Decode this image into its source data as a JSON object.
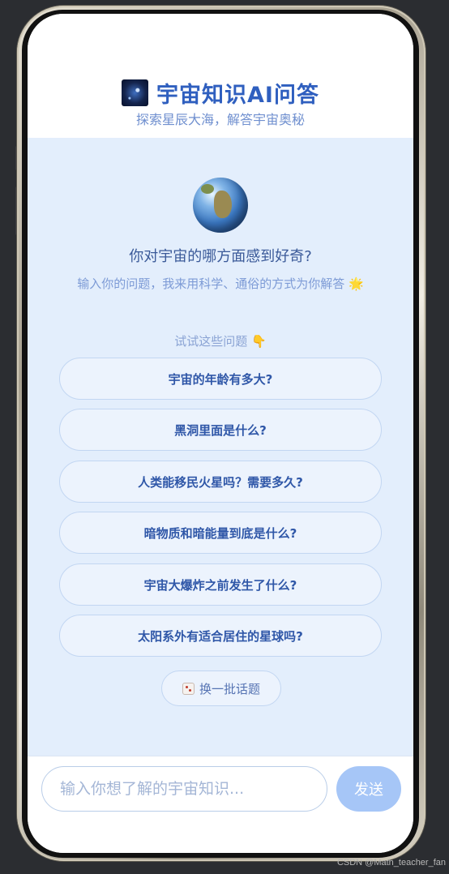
{
  "header": {
    "icon": "galaxy-icon",
    "title": "宇宙知识AI问答",
    "subtitle": "探索星辰大海，解答宇宙奥秘"
  },
  "welcome": {
    "icon": "earth-globe-icon",
    "heading": "你对宇宙的哪方面感到好奇?",
    "intro": "输入你的问题，我来用科学、通俗的方式为你解答 🌟",
    "try_label": "试试这些问题 👇"
  },
  "suggestions": [
    "宇宙的年龄有多大?",
    "黑洞里面是什么?",
    "人类能移民火星吗？需要多久?",
    "暗物质和暗能量到底是什么?",
    "宇宙大爆炸之前发生了什么?",
    "太阳系外有适合居住的星球吗?"
  ],
  "refresh_button": {
    "icon": "dice-icon",
    "label": "换一批话题"
  },
  "input_bar": {
    "placeholder": "输入你想了解的宇宙知识...",
    "value": "",
    "send_label": "发送"
  },
  "colors": {
    "accent": "#2f5fbf",
    "content_bg": "#e3eefc",
    "send_button": "#a6c6f7"
  },
  "watermark": "CSDN @Math_teacher_fan"
}
